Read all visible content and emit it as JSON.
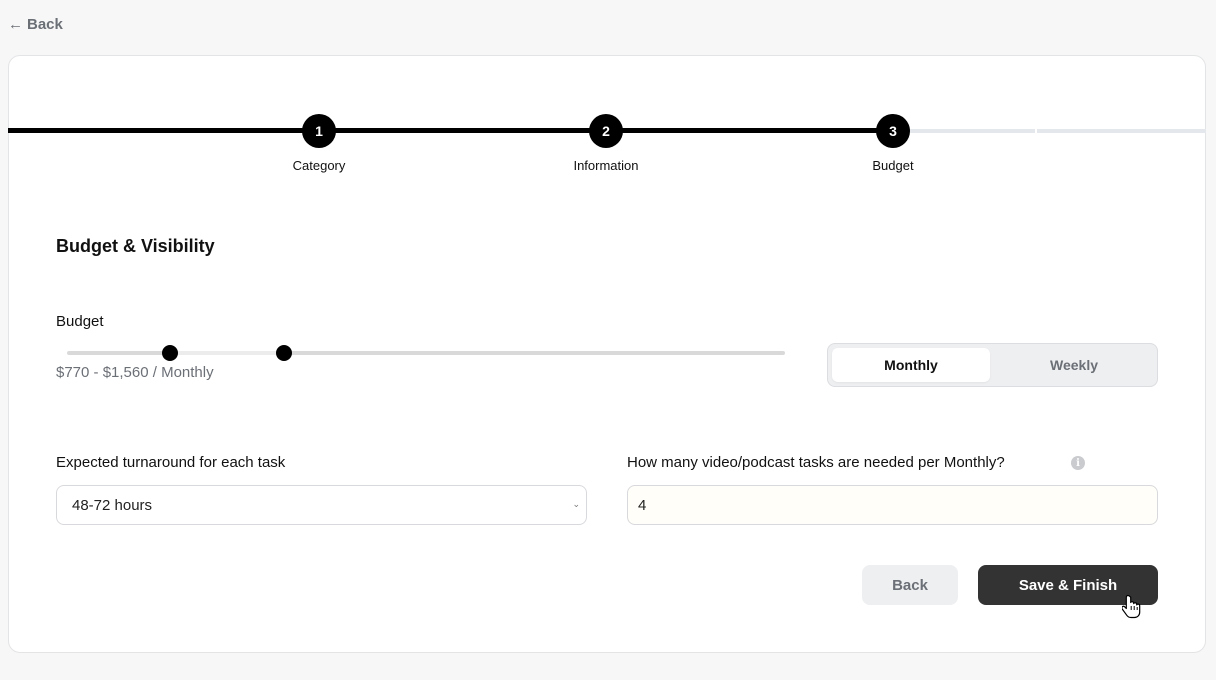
{
  "nav": {
    "back_arrow": "←",
    "back_label": "Back"
  },
  "stepper": {
    "steps": [
      {
        "number": "1",
        "label": "Category"
      },
      {
        "number": "2",
        "label": "Information"
      },
      {
        "number": "3",
        "label": "Budget"
      }
    ],
    "current_step": 3
  },
  "section": {
    "title": "Budget & Visibility"
  },
  "budget": {
    "label": "Budget",
    "range_text": "$770 - $1,560 / Monthly",
    "min_value": 770,
    "max_value": 1560
  },
  "period_toggle": {
    "options": [
      "Monthly",
      "Weekly"
    ],
    "selected": "Monthly"
  },
  "turnaround": {
    "label": "Expected turnaround for each task",
    "value": "48-72 hours",
    "chevron": "⌄"
  },
  "tasks_needed": {
    "label": "How many video/podcast tasks are needed per Monthly?",
    "value": "4",
    "info_icon": "i"
  },
  "actions": {
    "back_label": "Back",
    "save_label": "Save & Finish"
  },
  "colors": {
    "accent": "#000000",
    "primary_button": "#333333",
    "muted_text": "#6b6f76"
  }
}
